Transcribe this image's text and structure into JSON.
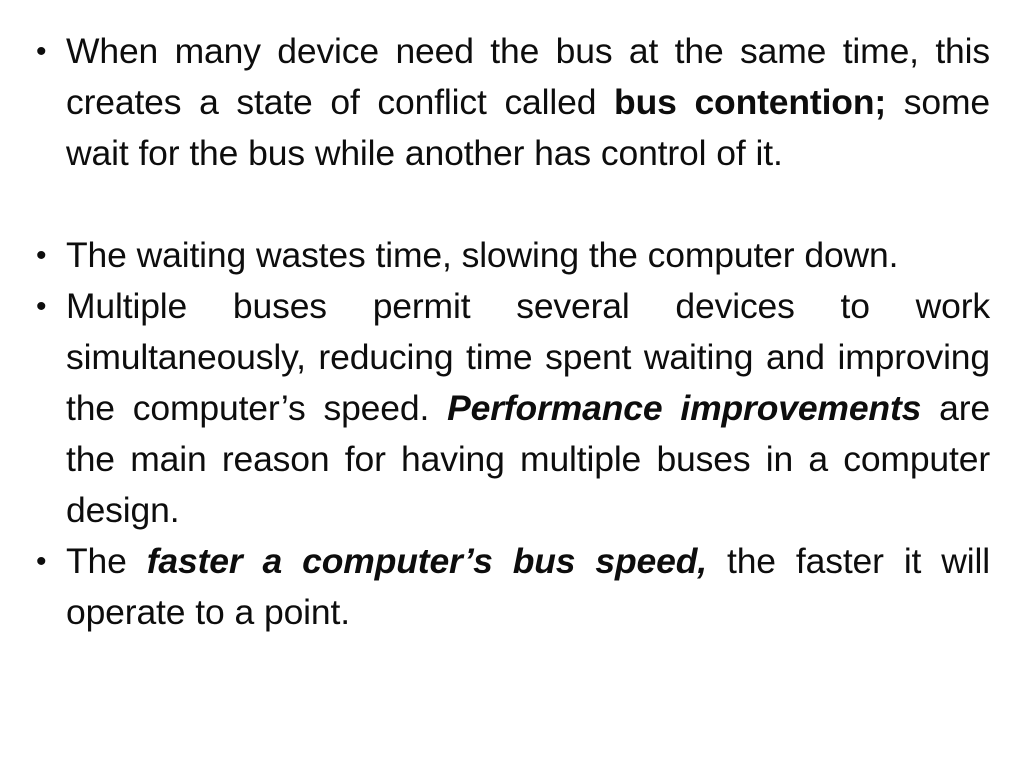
{
  "slide": {
    "background_color": "#ffffff",
    "text_color": "#0d0d0d",
    "bullet_glyph": "•",
    "bullets": [
      {
        "id": "bus-contention",
        "runs": [
          {
            "text": "When many device need the bus at the same time, this creates a state of conflict called ",
            "style": "normal"
          },
          {
            "text": "bus contention;",
            "style": "bold"
          },
          {
            "text": " some wait for the bus while another has control of it.",
            "style": "normal"
          }
        ]
      },
      {
        "id": "waiting-wastes-time",
        "runs": [
          {
            "text": "The waiting wastes time, slowing the computer down.",
            "style": "normal"
          }
        ]
      },
      {
        "id": "multiple-buses",
        "runs": [
          {
            "text": "Multiple buses permit several devices to work simultaneously, reducing time spent waiting and improving the computer’s speed. ",
            "style": "normal"
          },
          {
            "text": "Performance improvements",
            "style": "bold-italic"
          },
          {
            "text": " are the main reason for having multiple buses in a computer design.",
            "style": "normal"
          }
        ]
      },
      {
        "id": "bus-speed",
        "runs": [
          {
            "text": "The ",
            "style": "normal"
          },
          {
            "text": "faster a computer’s bus speed,",
            "style": "bold-italic"
          },
          {
            "text": " the faster it will operate to a point.",
            "style": "normal"
          }
        ]
      }
    ]
  }
}
